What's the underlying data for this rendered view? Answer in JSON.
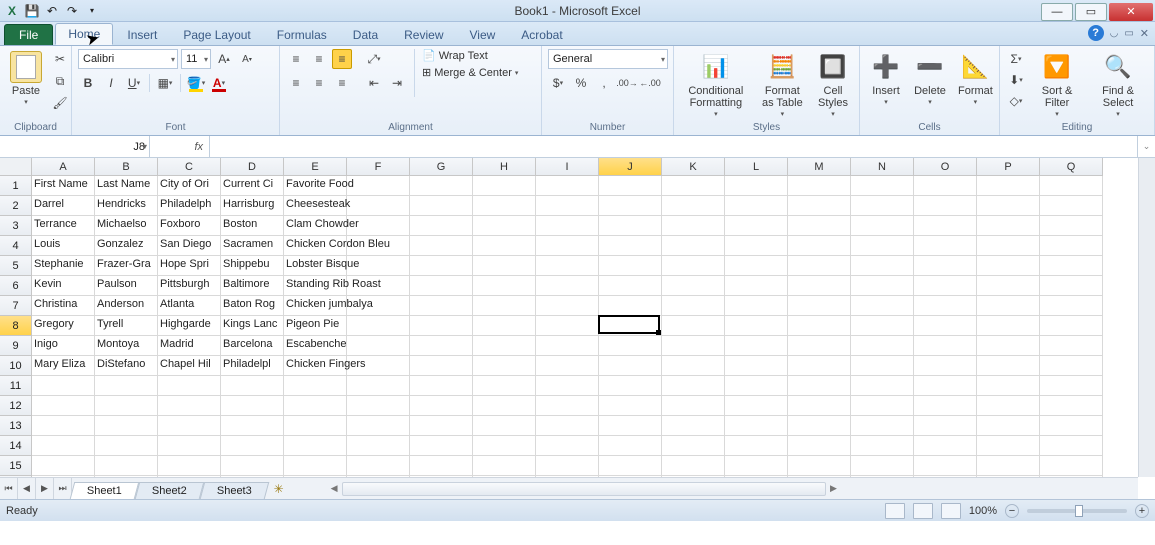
{
  "titlebar": {
    "title": "Book1 - Microsoft Excel"
  },
  "tabs": {
    "file": "File",
    "items": [
      "Home",
      "Insert",
      "Page Layout",
      "Formulas",
      "Data",
      "Review",
      "View",
      "Acrobat"
    ],
    "active": "Home"
  },
  "ribbon": {
    "clipboard": {
      "paste": "Paste",
      "label": "Clipboard"
    },
    "font": {
      "name": "Calibri",
      "size": "11",
      "label": "Font"
    },
    "alignment": {
      "wrap": "Wrap Text",
      "merge": "Merge & Center",
      "label": "Alignment"
    },
    "number": {
      "format": "General",
      "label": "Number"
    },
    "styles": {
      "cond": "Conditional Formatting",
      "table": "Format as Table",
      "cell": "Cell Styles",
      "label": "Styles"
    },
    "cells": {
      "insert": "Insert",
      "delete": "Delete",
      "format": "Format",
      "label": "Cells"
    },
    "editing": {
      "sort": "Sort & Filter",
      "find": "Find & Select",
      "label": "Editing"
    }
  },
  "formula": {
    "name": "J8",
    "fx": "fx",
    "value": ""
  },
  "columns": [
    "A",
    "B",
    "C",
    "D",
    "E",
    "F",
    "G",
    "H",
    "I",
    "J",
    "K",
    "L",
    "M",
    "N",
    "O",
    "P",
    "Q"
  ],
  "active_col": "J",
  "rows_shown": 16,
  "active_row": 8,
  "selected_cell": "J8",
  "data": {
    "1": [
      "First Name",
      "Last Name",
      "City of Ori",
      "Current Ci",
      "Favorite Food",
      "",
      "",
      "",
      "",
      "",
      "",
      "",
      "",
      "",
      "",
      "",
      ""
    ],
    "2": [
      "Darrel",
      "Hendricks",
      "Philadelph",
      "Harrisburg",
      "Cheesesteak",
      "",
      "",
      "",
      "",
      "",
      "",
      "",
      "",
      "",
      "",
      "",
      ""
    ],
    "3": [
      "Terrance",
      "Michaelso",
      "Foxboro",
      "Boston",
      "Clam Chowder",
      "",
      "",
      "",
      "",
      "",
      "",
      "",
      "",
      "",
      "",
      "",
      ""
    ],
    "4": [
      "Louis",
      "Gonzalez",
      "San Diego",
      "Sacramen",
      "Chicken Cordon Bleu",
      "",
      "",
      "",
      "",
      "",
      "",
      "",
      "",
      "",
      "",
      "",
      ""
    ],
    "5": [
      "Stephanie",
      "Frazer-Gra",
      "Hope Spri",
      "Shippebu",
      "Lobster Bisque",
      "",
      "",
      "",
      "",
      "",
      "",
      "",
      "",
      "",
      "",
      "",
      ""
    ],
    "6": [
      "Kevin",
      "Paulson",
      "Pittsburgh",
      "Baltimore",
      "Standing Rib Roast",
      "",
      "",
      "",
      "",
      "",
      "",
      "",
      "",
      "",
      "",
      "",
      ""
    ],
    "7": [
      "Christina",
      "Anderson",
      "Atlanta",
      "Baton Rog",
      "Chicken jumbalya",
      "",
      "",
      "",
      "",
      "",
      "",
      "",
      "",
      "",
      "",
      "",
      ""
    ],
    "8": [
      "Gregory",
      "Tyrell",
      "Highgarde",
      "Kings Lanc",
      "Pigeon Pie",
      "",
      "",
      "",
      "",
      "",
      "",
      "",
      "",
      "",
      "",
      "",
      ""
    ],
    "9": [
      "Inigo",
      "Montoya",
      "Madrid",
      "Barcelona",
      "Escabenche",
      "",
      "",
      "",
      "",
      "",
      "",
      "",
      "",
      "",
      "",
      "",
      ""
    ],
    "10": [
      "Mary Eliza",
      "DiStefano",
      "Chapel Hil",
      "Philadelpl",
      "Chicken Fingers",
      "",
      "",
      "",
      "",
      "",
      "",
      "",
      "",
      "",
      "",
      "",
      ""
    ]
  },
  "sheets": {
    "items": [
      "Sheet1",
      "Sheet2",
      "Sheet3"
    ],
    "active": "Sheet1"
  },
  "status": {
    "ready": "Ready",
    "zoom": "100%"
  }
}
